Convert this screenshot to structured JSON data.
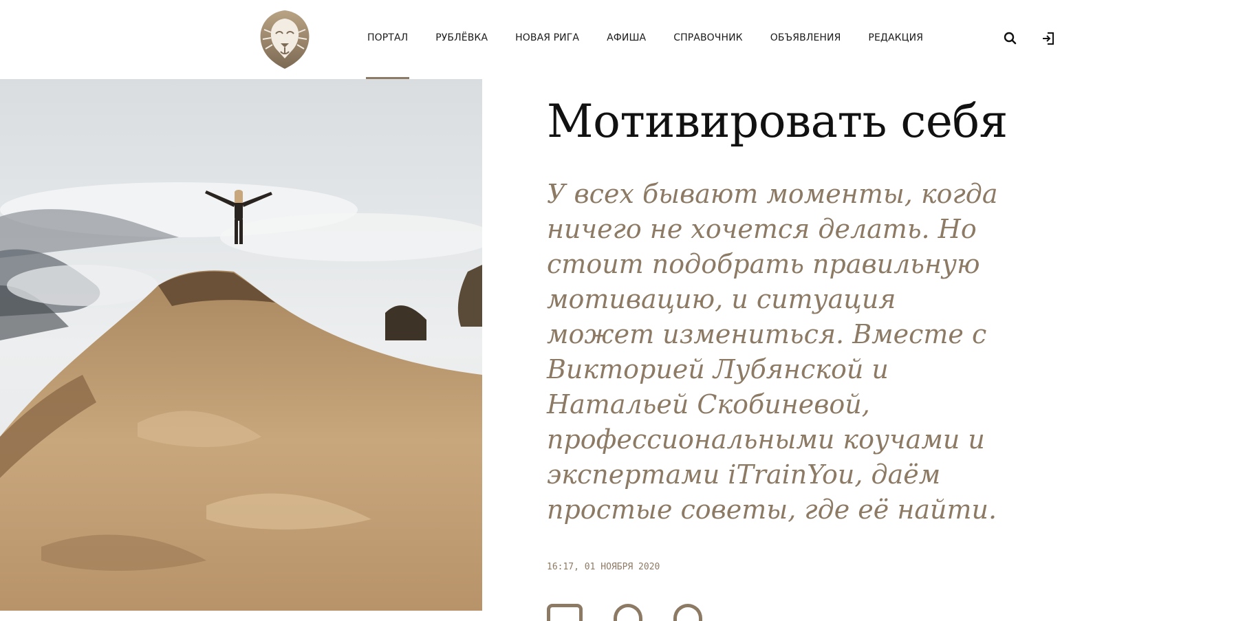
{
  "header": {
    "logo_icon": "lion-emblem-icon",
    "nav": [
      {
        "label": "ПОРТАЛ",
        "active": true
      },
      {
        "label": "РУБЛЁВКА",
        "active": false
      },
      {
        "label": "НОВАЯ РИГА",
        "active": false
      },
      {
        "label": "АФИША",
        "active": false
      },
      {
        "label": "СПРАВОЧНИК",
        "active": false
      },
      {
        "label": "ОБЪЯВЛЕНИЯ",
        "active": false
      },
      {
        "label": "РЕДАКЦИЯ",
        "active": false
      }
    ],
    "search_icon": "search-icon",
    "login_icon": "login-icon"
  },
  "article": {
    "title": "Мотивировать себя",
    "lead": "У всех бывают моменты, когда ничего не хочется делать. Но стоит подобрать правильную мотивацию, и ситуация может измениться. Вместе с Викторией Лубянской и Натальей Скобиневой, профессиональными коучами и экспертами iTrainYou, даём простые советы, где её найти.",
    "date": "16:17, 01 ноября 2020"
  },
  "colors": {
    "accent": "#8c7a64",
    "title": "#111111"
  }
}
